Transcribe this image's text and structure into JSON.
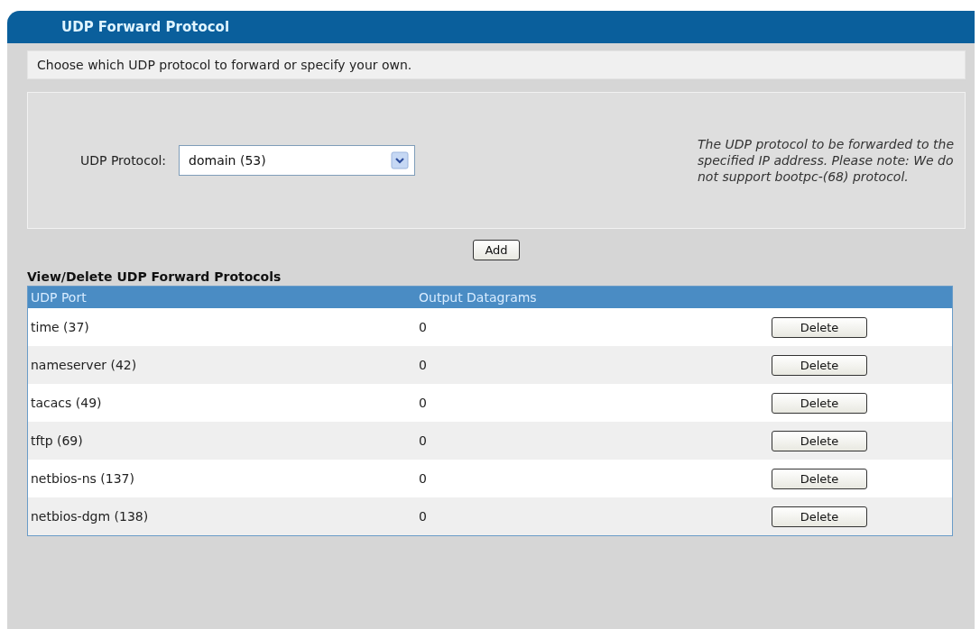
{
  "panel": {
    "title": "UDP Forward Protocol"
  },
  "intro": "Choose which UDP protocol to forward or specify your own.",
  "form": {
    "label": "UDP Protocol:",
    "select_value": "domain (53)",
    "help": "The UDP protocol to be forwarded to the specified IP address. Please note: We do not support bootpc-(68) protocol."
  },
  "add_button": "Add",
  "table": {
    "title": "View/Delete UDP Forward Protocols",
    "columns": [
      "UDP Port",
      "Output Datagrams"
    ],
    "rows": [
      {
        "port": "time (37)",
        "datagrams": "0",
        "action": "Delete"
      },
      {
        "port": "nameserver (42)",
        "datagrams": "0",
        "action": "Delete"
      },
      {
        "port": "tacacs (49)",
        "datagrams": "0",
        "action": "Delete"
      },
      {
        "port": "tftp (69)",
        "datagrams": "0",
        "action": "Delete"
      },
      {
        "port": "netbios-ns (137)",
        "datagrams": "0",
        "action": "Delete"
      },
      {
        "port": "netbios-dgm (138)",
        "datagrams": "0",
        "action": "Delete"
      }
    ]
  }
}
